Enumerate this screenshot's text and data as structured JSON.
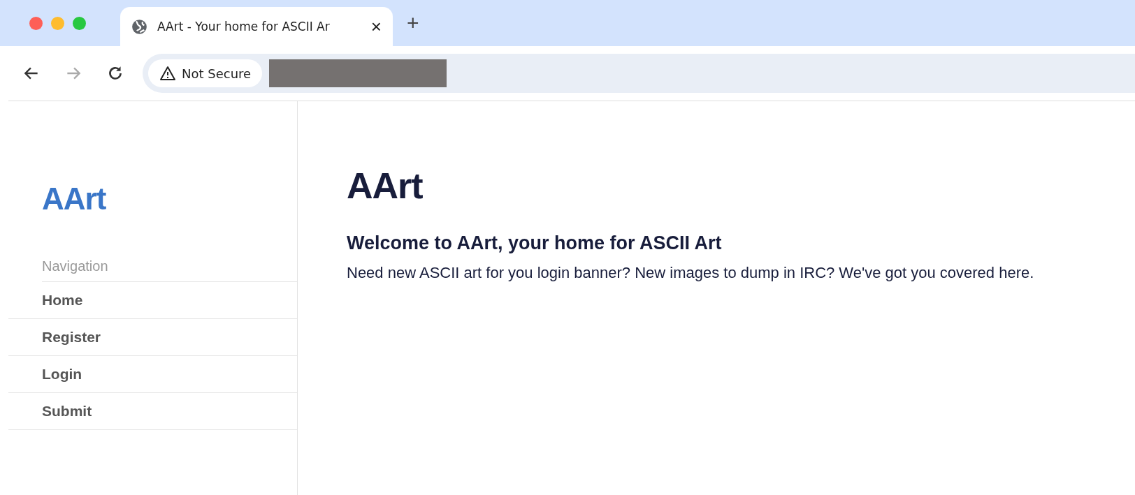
{
  "browser": {
    "tabs": [
      {
        "title": "AArt - Your home for ASCII Ar",
        "selected": true
      }
    ],
    "new_tab": "+",
    "close": "×",
    "security_label": "Not Secure",
    "address_redacted": true
  },
  "sidebar": {
    "logo": "AArt",
    "heading": "Navigation",
    "items": [
      {
        "label": "Home"
      },
      {
        "label": "Register"
      },
      {
        "label": "Login"
      },
      {
        "label": "Submit"
      }
    ]
  },
  "main": {
    "title": "AArt",
    "subtitle": "Welcome to AArt, your home for ASCII Art",
    "text": "Need new ASCII art for you login banner? New images to dump in IRC? We've got you covered here."
  }
}
